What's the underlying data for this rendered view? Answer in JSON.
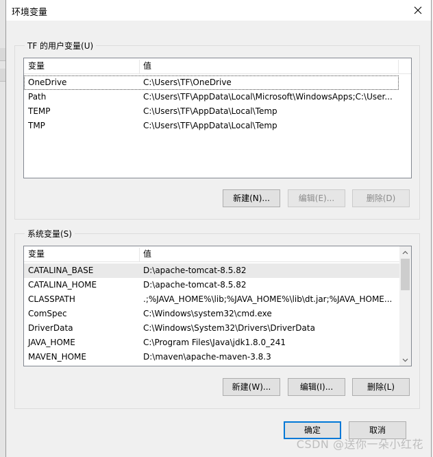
{
  "dialog": {
    "title": "环境变量",
    "ok_label": "确定",
    "cancel_label": "取消",
    "close_icon": "close-icon"
  },
  "user_vars": {
    "group_label": "TF 的用户变量(U)",
    "col_name": "变量",
    "col_value": "值",
    "rows": [
      {
        "name": "OneDrive",
        "value": "C:\\Users\\TF\\OneDrive"
      },
      {
        "name": "Path",
        "value": "C:\\Users\\TF\\AppData\\Local\\Microsoft\\WindowsApps;C:\\User..."
      },
      {
        "name": "TEMP",
        "value": "C:\\Users\\TF\\AppData\\Local\\Temp"
      },
      {
        "name": "TMP",
        "value": "C:\\Users\\TF\\AppData\\Local\\Temp"
      }
    ],
    "new_label": "新建(N)...",
    "edit_label": "编辑(E)...",
    "delete_label": "删除(D)"
  },
  "system_vars": {
    "group_label": "系统变量(S)",
    "col_name": "变量",
    "col_value": "值",
    "rows": [
      {
        "name": "CATALINA_BASE",
        "value": "D:\\apache-tomcat-8.5.82"
      },
      {
        "name": "CATALINA_HOME",
        "value": "D:\\apache-tomcat-8.5.82"
      },
      {
        "name": "CLASSPATH",
        "value": ".;%JAVA_HOME%\\lib;%JAVA_HOME%\\lib\\dt.jar;%JAVA_HOME..."
      },
      {
        "name": "ComSpec",
        "value": "C:\\Windows\\system32\\cmd.exe"
      },
      {
        "name": "DriverData",
        "value": "C:\\Windows\\System32\\Drivers\\DriverData"
      },
      {
        "name": "JAVA_HOME",
        "value": "C:\\Program Files\\Java\\jdk1.8.0_241"
      },
      {
        "name": "MAVEN_HOME",
        "value": "D:\\maven\\apache-maven-3.8.3"
      }
    ],
    "new_label": "新建(W)...",
    "edit_label": "编辑(I)...",
    "delete_label": "删除(L)"
  },
  "watermark": "CSDN @送你一朵小红花"
}
